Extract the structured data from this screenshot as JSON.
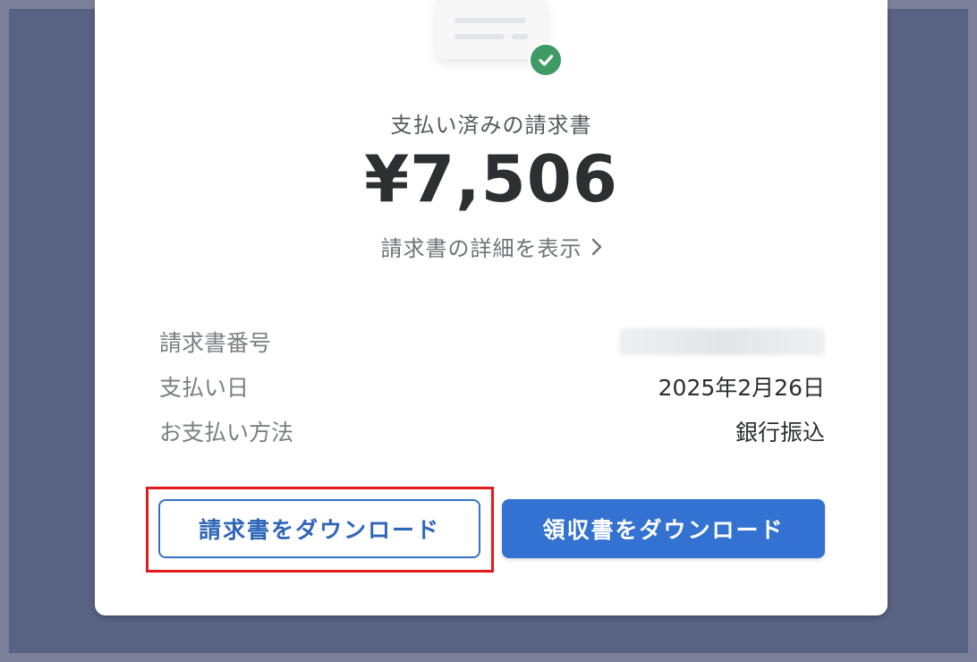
{
  "invoice": {
    "status_caption": "支払い済みの請求書",
    "amount": "¥7,506",
    "details_link_label": "請求書の詳細を表示"
  },
  "details": [
    {
      "label": "請求書番号",
      "value": ""
    },
    {
      "label": "支払い日",
      "value": "2025年2月26日"
    },
    {
      "label": "お支払い方法",
      "value": "銀行振込"
    }
  ],
  "actions": {
    "download_invoice_label": "請求書をダウンロード",
    "download_receipt_label": "領収書をダウンロード"
  },
  "colors": {
    "accent": "#3372d0",
    "success": "#3f9b63",
    "highlight": "#e21a1a",
    "page_background": "#596283"
  },
  "icons": {
    "status": "check-circle-icon",
    "link": "chevron-right-icon",
    "illustration": "document-icon"
  }
}
